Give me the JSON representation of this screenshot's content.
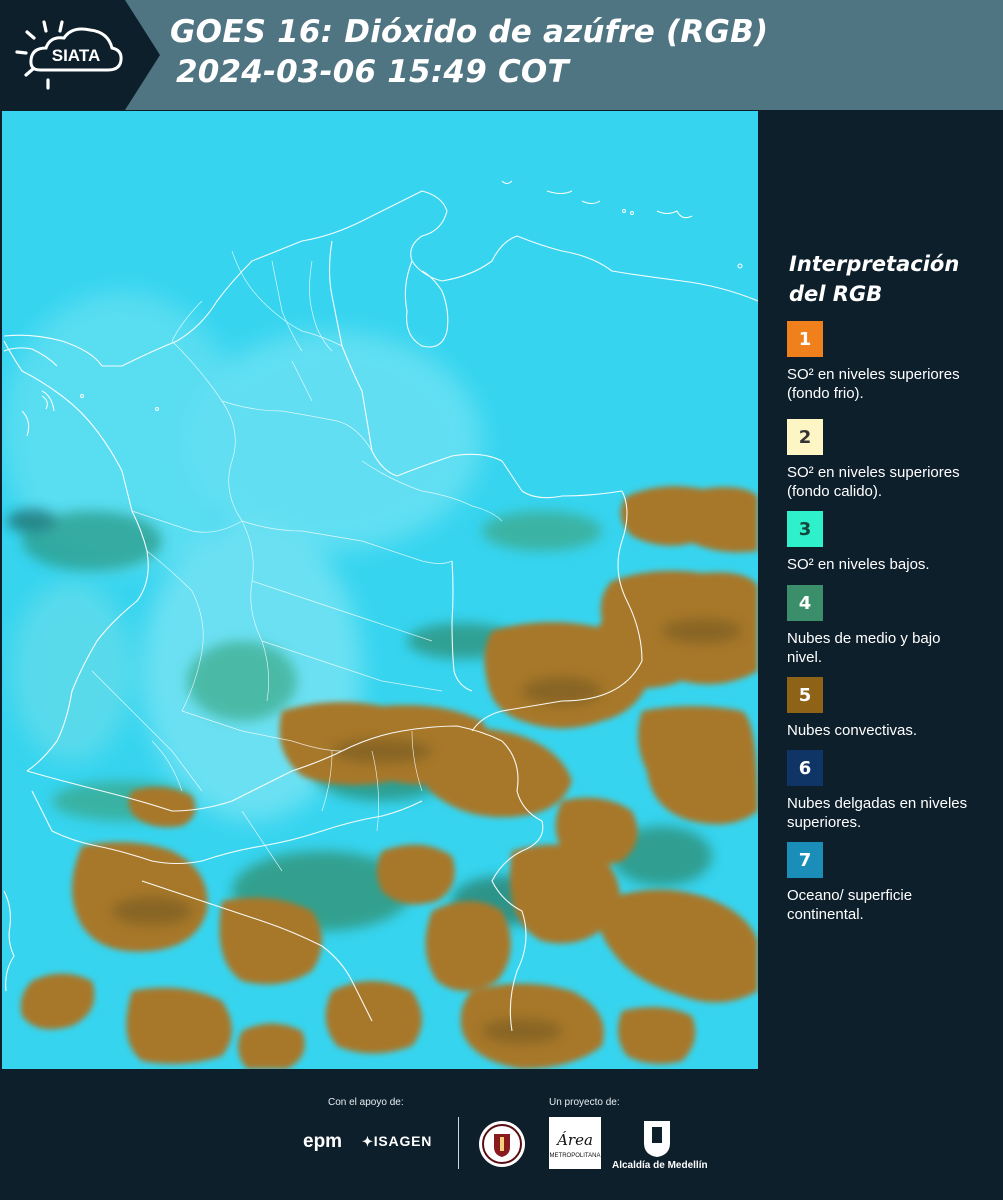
{
  "header": {
    "logo_text": "SIATA",
    "title_line1": "GOES 16: Dióxido de azúfre (RGB)",
    "title_line2": "2024-03-06 15:49 COT"
  },
  "legend": {
    "title": "Interpretación del RGB",
    "items": [
      {
        "number": "1",
        "label": "SO² en niveles superiores (fondo frio).",
        "color": "#f0801c",
        "text_color": "#ffffff"
      },
      {
        "number": "2",
        "label": "SO² en niveles superiores (fondo calido).",
        "color": "#fdf6c4",
        "text_color": "#333333"
      },
      {
        "number": "3",
        "label": "SO² en niveles bajos.",
        "color": "#2ef1cc",
        "text_color": "#13463c"
      },
      {
        "number": "4",
        "label": "Nubes de medio y bajo nivel.",
        "color": "#3a8f6a",
        "text_color": "#ffffff"
      },
      {
        "number": "5",
        "label": "Nubes convectivas.",
        "color": "#8e6217",
        "text_color": "#ffffff"
      },
      {
        "number": "6",
        "label": "Nubes delgadas en niveles superiores.",
        "color": "#0e3566",
        "text_color": "#ffffff"
      },
      {
        "number": "7",
        "label": "Oceano/ superficie continental.",
        "color": "#1a8db8",
        "text_color": "#ffffff"
      }
    ]
  },
  "footer": {
    "support_caption": "Con el apoyo de:",
    "project_caption": "Un proyecto de:",
    "epm_text": "epm",
    "isagen_text": "ISAGEN",
    "area_text": "Área",
    "area_subtext": "METROPOLITANA",
    "alcaldia_text": "Alcaldía de Medellín"
  },
  "colors": {
    "header_bg": "#4f7482",
    "logo_bg": "#0e1f2c",
    "page_bg": "#0e1f2c",
    "map_sky": "#36d4ef",
    "convective_cloud": "#a7782a",
    "border_lines": "#ffffff"
  }
}
